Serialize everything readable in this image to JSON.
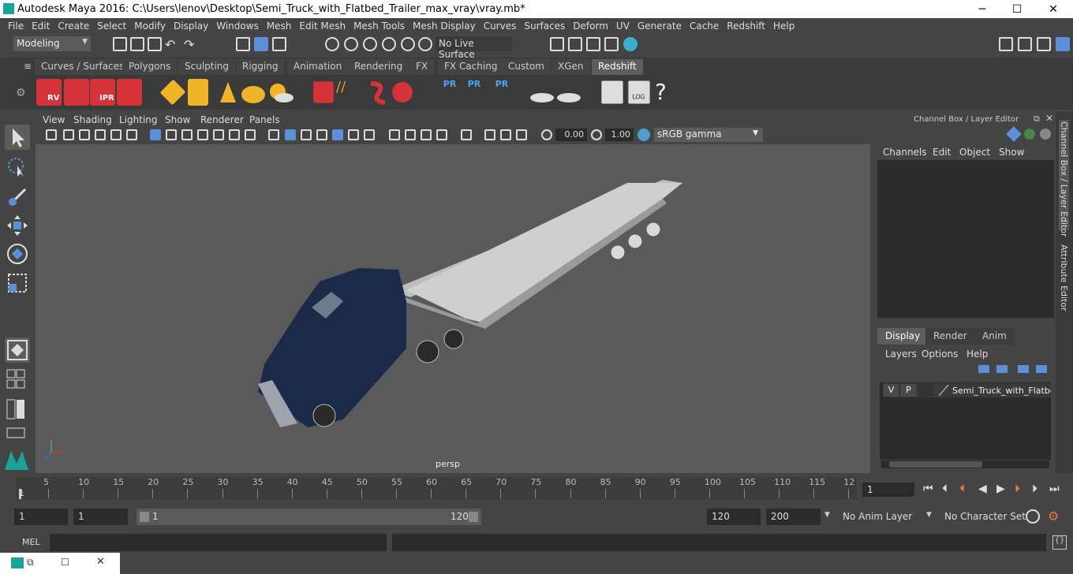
{
  "window": {
    "title": "Autodesk Maya 2016: C:\\Users\\lenov\\Desktop\\Semi_Truck_with_Flatbed_Trailer_max_vray\\vray.mb*",
    "minimize": "─",
    "maximize": "☐",
    "close": "✕"
  },
  "menubar": [
    "File",
    "Edit",
    "Create",
    "Select",
    "Modify",
    "Display",
    "Windows",
    "Mesh",
    "Edit Mesh",
    "Mesh Tools",
    "Mesh Display",
    "Curves",
    "Surfaces",
    "Deform",
    "UV",
    "Generate",
    "Cache",
    "Redshift",
    "Help"
  ],
  "status": {
    "mode": "Modeling",
    "live_surface": "No Live Surface"
  },
  "shelf_tabs": [
    "Curves / Surfaces",
    "Polygons",
    "Sculpting",
    "Rigging",
    "Animation",
    "Rendering",
    "FX",
    "FX Caching",
    "Custom",
    "XGen",
    "Redshift"
  ],
  "shelf_selected": "Redshift",
  "shelf_labels": {
    "rv": "RV",
    "ipr": "IPR",
    "pr": "PR",
    "log": "LOG",
    "help": "?"
  },
  "viewport": {
    "menu": [
      "View",
      "Shading",
      "Lighting",
      "Show",
      "Renderer",
      "Panels"
    ],
    "exposure": "0.00",
    "gamma_value": "1.00",
    "color_space": "sRGB gamma",
    "camera": "persp"
  },
  "channel_box": {
    "title": "Channel Box / Layer Editor",
    "menu": [
      "Channels",
      "Edit",
      "Object",
      "Show"
    ]
  },
  "layer_editor": {
    "tabs": [
      "Display",
      "Render",
      "Anim"
    ],
    "selected_tab": "Display",
    "menu": [
      "Layers",
      "Options",
      "Help"
    ],
    "layer": {
      "v": "V",
      "p": "P",
      "name": "Semi_Truck_with_Flatbed_Trailer"
    }
  },
  "side_tabs": [
    "Channel Box / Layer Editor",
    "Attribute Editor"
  ],
  "timeline": {
    "ticks": [
      "5",
      "10",
      "15",
      "20",
      "25",
      "30",
      "35",
      "40",
      "45",
      "50",
      "55",
      "60",
      "65",
      "70",
      "75",
      "80",
      "85",
      "90",
      "95",
      "100",
      "105",
      "110",
      "115",
      "12"
    ],
    "start_label": "1",
    "current_frame": "1"
  },
  "range": {
    "start": "1",
    "playback_start": "1",
    "slider_start": "1",
    "slider_end": "120",
    "playback_end": "120",
    "end": "200",
    "anim_layer": "No Anim Layer",
    "character_set": "No Character Set"
  },
  "command_line": {
    "label": "MEL"
  },
  "colors": {
    "accent": "#5b8fd8",
    "redshift": "#d6323a",
    "truck": "#1c2a4a",
    "trailer": "#c8c8c8"
  }
}
